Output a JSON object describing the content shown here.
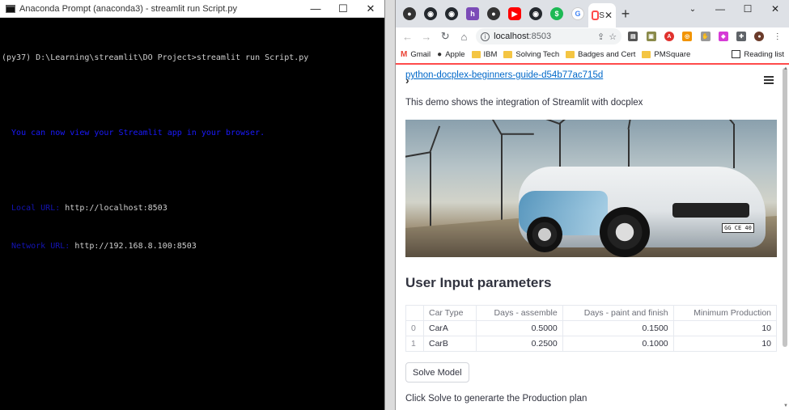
{
  "terminal": {
    "title": "Anaconda Prompt (anaconda3) - streamlit  run Script.py",
    "lines": {
      "cmd": "(py37) D:\\Learning\\streamlit\\DO Project>streamlit run Script.py",
      "msg": "  You can now view your Streamlit app in your browser.",
      "local_label": "  Local URL: ",
      "local_url": "http://localhost:8503",
      "network_label": "  Network URL: ",
      "network_url": "http://192.168.8.100:8503"
    }
  },
  "window_controls": {
    "minimize": "—",
    "maximize": "☐",
    "close": "✕"
  },
  "browser": {
    "active_tab_label": "S",
    "new_tab": "+",
    "address": {
      "host": "localhost",
      "port": ":8503"
    },
    "bookmarks": [
      "Gmail",
      "Apple",
      "IBM",
      "Solving Tech",
      "Badges and Cert",
      "PMSquare"
    ],
    "reading_list": "Reading list"
  },
  "page": {
    "link": "python-docplex-beginners-guide-d54b77ac715d",
    "intro": "This demo shows the integration of Streamlit with docplex",
    "plate": "GG CE 40",
    "section_title": "User Input parameters",
    "table": {
      "headers": [
        "",
        "Car Type",
        "Days - assemble",
        "Days - paint and finish",
        "Minimum Production"
      ],
      "rows": [
        [
          "0",
          "CarA",
          "0.5000",
          "0.1500",
          "10"
        ],
        [
          "1",
          "CarB",
          "0.2500",
          "0.1000",
          "10"
        ]
      ]
    },
    "solve_button": "Solve Model",
    "hint": "Click Solve to generarte the Production plan"
  },
  "colors": {
    "streamlit_red": "#ff4b4b",
    "link_blue": "#0068c9",
    "terminal_blue": "#1a1aff"
  }
}
